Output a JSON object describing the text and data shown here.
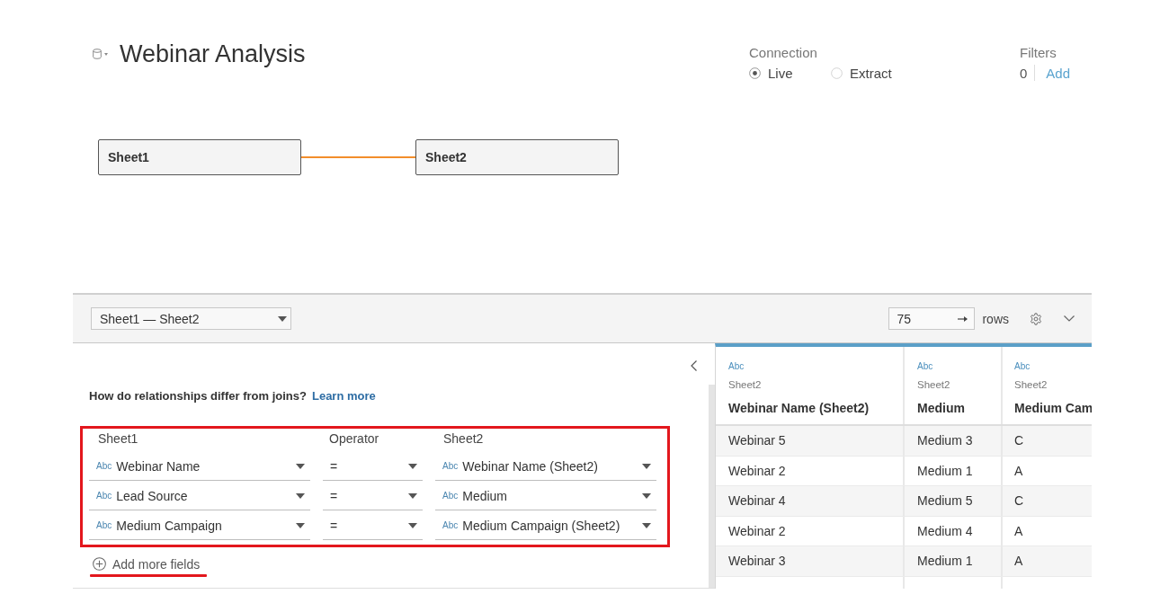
{
  "header": {
    "title": "Webinar Analysis"
  },
  "connection": {
    "label": "Connection",
    "options": [
      {
        "label": "Live",
        "selected": true
      },
      {
        "label": "Extract",
        "selected": false
      }
    ]
  },
  "filters": {
    "label": "Filters",
    "count": "0",
    "action": "Add"
  },
  "canvas": {
    "tables": [
      {
        "name": "Sheet1"
      },
      {
        "name": "Sheet2"
      }
    ]
  },
  "toolbar": {
    "relationship": "Sheet1 — Sheet2",
    "rows_value": "75",
    "rows_label": "rows"
  },
  "relationship_panel": {
    "intro": "How do relationships differ from joins?",
    "link": "Learn more",
    "columns": [
      "Sheet1",
      "Operator",
      "Sheet2"
    ],
    "highlighted": true,
    "conditions": [
      {
        "left_type": "Abc",
        "left": "Webinar Name",
        "operator": "=",
        "right_type": "Abc",
        "right": "Webinar Name (Sheet2)"
      },
      {
        "left_type": "Abc",
        "left": "Lead Source",
        "operator": "=",
        "right_type": "Abc",
        "right": "Medium"
      },
      {
        "left_type": "Abc",
        "left": "Medium Campaign",
        "operator": "=",
        "right_type": "Abc",
        "right": "Medium Campaign (Sheet2)"
      }
    ],
    "add_fields": {
      "label": "Add more fields",
      "underlined": true
    }
  },
  "data_grid": {
    "columns": [
      {
        "type": "Abc",
        "source": "Sheet2",
        "name": "Webinar Name (Sheet2)"
      },
      {
        "type": "Abc",
        "source": "Sheet2",
        "name": "Medium"
      },
      {
        "type": "Abc",
        "source": "Sheet2",
        "name": "Medium Cam"
      }
    ],
    "rows": [
      [
        "Webinar 5",
        "Medium 3",
        "C"
      ],
      [
        "Webinar 2",
        "Medium 1",
        "A"
      ],
      [
        "Webinar 4",
        "Medium 5",
        "C"
      ],
      [
        "Webinar 2",
        "Medium 4",
        "A"
      ],
      [
        "Webinar 3",
        "Medium 1",
        "A"
      ]
    ]
  }
}
